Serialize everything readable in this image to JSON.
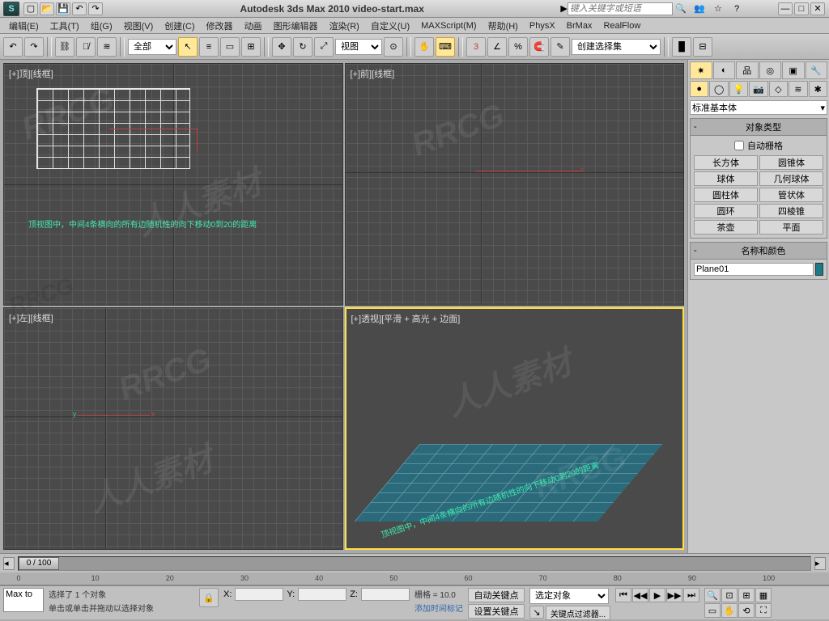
{
  "title": "Autodesk 3ds Max 2010  video-start.max",
  "search_placeholder": "键入关键字或短语",
  "menu": [
    "编辑(E)",
    "工具(T)",
    "组(G)",
    "视图(V)",
    "创建(C)",
    "修改器",
    "动画",
    "图形编辑器",
    "渲染(R)",
    "自定义(U)",
    "MAXScript(M)",
    "帮助(H)",
    "PhysX",
    "BrMax",
    "RealFlow"
  ],
  "toolbar": {
    "sel_filter": "全部",
    "ref_coord": "视图",
    "named_sel": "创建选择集"
  },
  "viewports": {
    "top": "[+]顶][线框]",
    "front": "[+]前][线框]",
    "left": "[+]左][线框]",
    "persp": "[+]透视][平滑 + 高光 + 边面]",
    "note1": "顶视图中，中间4条横向的所有边随机性的向下移动0到20的距离",
    "note2": "顶视图中，中间4条横向的所有边随机性的向下移动0到20的距离"
  },
  "panel": {
    "dropdown": "标准基本体",
    "section1": "对象类型",
    "autogrid": "自动栅格",
    "prims": [
      [
        "长方体",
        "圆锥体"
      ],
      [
        "球体",
        "几何球体"
      ],
      [
        "圆柱体",
        "管状体"
      ],
      [
        "圆环",
        "四棱锥"
      ],
      [
        "茶壶",
        "平面"
      ]
    ],
    "section2": "名称和颜色",
    "obj_name": "Plane01"
  },
  "timeline": {
    "pos": "0 / 100",
    "ticks": [
      "0",
      "10",
      "20",
      "30",
      "40",
      "50",
      "60",
      "70",
      "80",
      "90",
      "100"
    ]
  },
  "status": {
    "sel": "选择了 1 个对象",
    "hint": "单击或单击并拖动以选择对象",
    "x": "X:",
    "y": "Y:",
    "z": "Z:",
    "grid_label": "栅格 = 10.0",
    "add_time": "添加时间标记",
    "autokey": "自动关键点",
    "setkey": "设置关键点",
    "sel_obj": "选定对象",
    "key_filter": "关键点过滤器...",
    "maxto": "Max to"
  }
}
